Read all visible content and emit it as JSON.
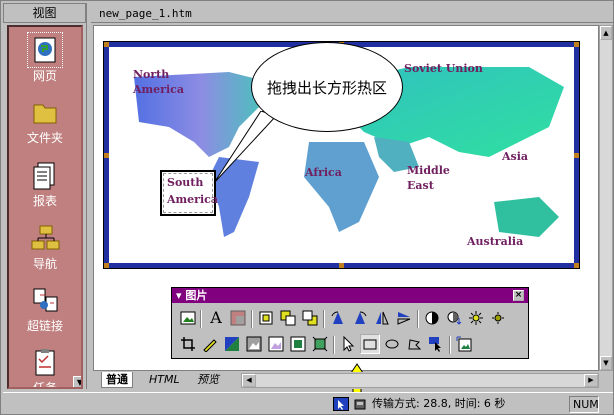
{
  "sidebar": {
    "title": "视图",
    "items": [
      {
        "label": "网页",
        "icon": "web-page-icon"
      },
      {
        "label": "文件夹",
        "icon": "folder-icon"
      },
      {
        "label": "报表",
        "icon": "reports-icon"
      },
      {
        "label": "导航",
        "icon": "navigation-icon"
      },
      {
        "label": "超链接",
        "icon": "hyperlinks-icon"
      },
      {
        "label": "任务",
        "icon": "tasks-icon"
      }
    ]
  },
  "editor": {
    "file_tab": "new_page_1.htm",
    "map_labels": {
      "north_america": "North\nAmerica",
      "soviet_union": "Soviet Union",
      "africa": "Africa",
      "middle_east": "Middle\nEast",
      "asia": "Asia",
      "australia": "Australia",
      "south_america_line1": "South",
      "south_america_line2": "America"
    },
    "callout": "拖拽出长方形热区"
  },
  "palette": {
    "title": "图片",
    "row1": [
      "insert-picture-icon",
      "text-icon",
      "auto-thumbnail-icon",
      "position-absolutely-icon",
      "bring-forward-icon",
      "send-backward-icon",
      "rotate-left-icon",
      "rotate-right-icon",
      "flip-horizontal-icon",
      "flip-vertical-icon",
      "more-contrast-icon",
      "less-contrast-icon",
      "more-brightness-icon",
      "less-brightness-icon"
    ],
    "row2": [
      "crop-icon",
      "line-style-icon",
      "set-transparent-color-icon",
      "black-white-icon",
      "wash-out-icon",
      "bevel-icon",
      "resample-icon",
      "select-icon",
      "rectangle-hotspot-icon",
      "circle-hotspot-icon",
      "polygon-hotspot-icon",
      "highlight-hotspots-icon",
      "restore-icon"
    ]
  },
  "view_tabs": {
    "normal": "普通",
    "html": "HTML",
    "preview": "预览"
  },
  "status": {
    "transfer": "传输方式: 28.8, 时间: 6 秒",
    "num": "NUM"
  },
  "colors": {
    "accent": "#800080",
    "map_border": "#2030a0",
    "label": "#702060"
  }
}
